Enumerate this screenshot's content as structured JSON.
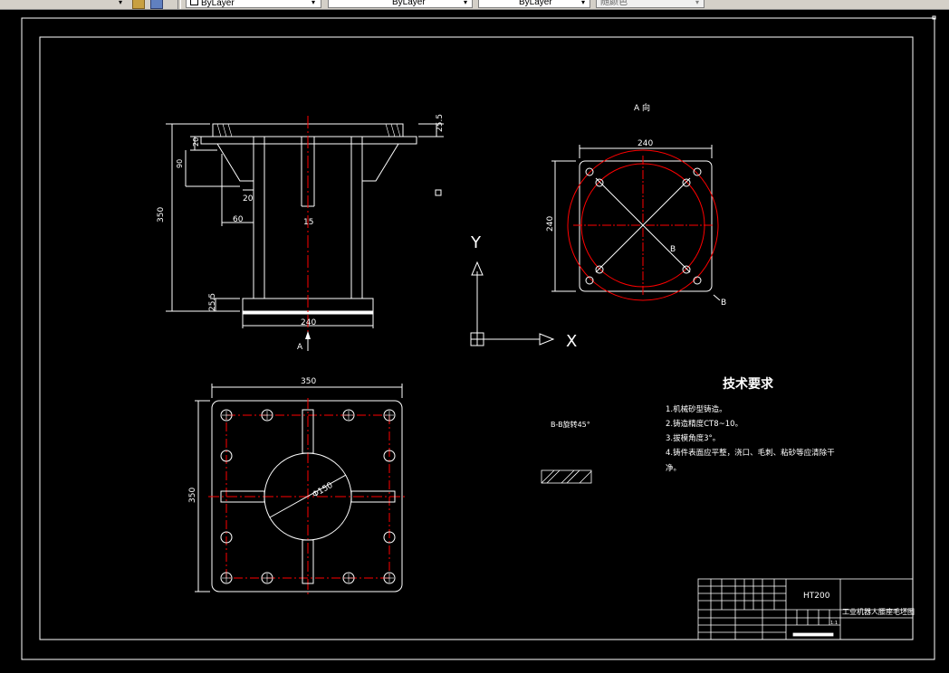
{
  "toolbar": {
    "color_control": "ByLayer",
    "linetype_control": "ByLayer",
    "lineweight_control": "ByLayer",
    "plotstyle_control": "随颜色"
  },
  "drawing": {
    "view_a_label": "A 向",
    "top_width_dim": "240",
    "top_height_dim": "240",
    "b_label": "B",
    "b_label2": "B",
    "front": {
      "dim_flange": "25.5",
      "dim_20_top": "20",
      "dim_90": "90",
      "dim_350": "350",
      "dim_20_rib": "20",
      "dim_60": "60",
      "dim_15": "15",
      "dim_base": "25.5",
      "dim_240": "240",
      "arrow_a": "A"
    },
    "ucs": {
      "y": "Y",
      "x": "X"
    },
    "section_label": "B-B旋转45°",
    "bottom": {
      "dim_width": "350",
      "dim_height": "350",
      "dim_dia": "Φ150"
    },
    "tech": {
      "title": "技术要求",
      "items": [
        "1.机械砂型铸造。",
        "2.铸造精度CT8~10。",
        "3.拔模角度3°。",
        "4.铸件表面应平整，浇口、毛刺、粘砂等应清除干",
        "净。"
      ]
    },
    "title_block": {
      "material": "HT200",
      "drawing_name": "工业机器人腰座毛坯图",
      "scale": "1:1"
    }
  },
  "colors": {
    "background": "#000000",
    "line_white": "#ffffff",
    "line_red": "#ff0000",
    "toolbar": "#d4d0c8"
  }
}
